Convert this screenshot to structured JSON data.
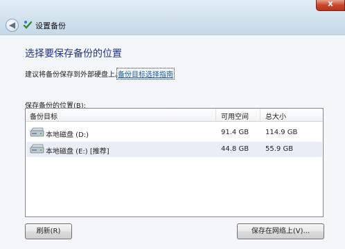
{
  "window": {
    "title": "设置备份",
    "close_label": "X",
    "back_glyph": "◀",
    "app_icon": "backup-icon"
  },
  "heading": "选择要保存备份的位置",
  "suggestion": {
    "text": "建议将备份保存到外部硬盘上。",
    "link": "备份目标选择指南"
  },
  "location_label": "保存备份的位置(B):",
  "table": {
    "columns": [
      "备份目标",
      "可用空间",
      "总大小"
    ],
    "rows": [
      {
        "icon": "hard-drive-icon",
        "name": "本地磁盘 (D:)",
        "free": "91.4 GB",
        "total": "114.9 GB",
        "selected": false
      },
      {
        "icon": "hard-drive-icon",
        "name": "本地磁盘 (E:) [推荐]",
        "free": "44.8 GB",
        "total": "55.9 GB",
        "selected": true
      }
    ]
  },
  "buttons": {
    "refresh": "刷新(R)",
    "save_network": "保存在网络上(V)..."
  },
  "colors": {
    "heading": "#1e3287",
    "link": "#1c5a9e",
    "close_button": "#c9452c"
  }
}
